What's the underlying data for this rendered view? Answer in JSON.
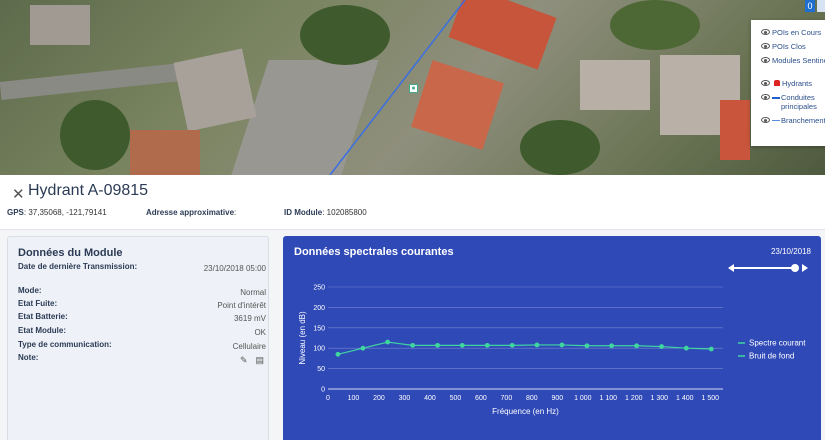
{
  "map": {
    "counter": "0"
  },
  "legend": {
    "items": [
      {
        "label": "POIs en Cours",
        "icon": "eye-slash-icon"
      },
      {
        "label": "POIs Clos",
        "icon": "eye-slash-icon"
      },
      {
        "label": "Modules Sentinel",
        "icon": "eye-icon"
      },
      {
        "label": "Hydrants",
        "icon": "hydrant-icon"
      },
      {
        "label": "Conduites principales",
        "icon": "line-icon"
      },
      {
        "label": "Branchement",
        "icon": "line-icon"
      }
    ]
  },
  "header": {
    "title": "Hydrant A-09815",
    "gps_label": "GPS",
    "gps_value": ": 37,35068, -121,79141",
    "address_label": "Adresse approximative",
    "address_value": ":",
    "module_label": "ID Module",
    "module_value": ": 102085800"
  },
  "module": {
    "title": "Données du Module",
    "rows": [
      {
        "key": "Date de dernière Transmission:",
        "value": "23/10/2018 05:00"
      },
      {
        "key": "Mode:",
        "value": "Normal"
      },
      {
        "key": "Etat Fuite:",
        "value": "Point d'intérêt"
      },
      {
        "key": "Etat Batterie:",
        "value": "3619 mV"
      },
      {
        "key": "Etat Module:",
        "value": "OK"
      },
      {
        "key": "Type de communication:",
        "value": "Cellulaire"
      },
      {
        "key": "Note:",
        "value": ""
      }
    ]
  },
  "spectral": {
    "title": "Données spectrales courantes",
    "date": "23/10/2018"
  },
  "colors": {
    "panel_blue": "#2f49b7",
    "series_green": "#3fd6a0"
  },
  "chart_data": {
    "type": "line",
    "xlabel": "Fréquence (en Hz)",
    "ylabel": "Niveau (en dB)",
    "xlim": [
      0,
      1550
    ],
    "ylim": [
      0,
      250
    ],
    "x_ticks": [
      0,
      100,
      200,
      300,
      400,
      500,
      600,
      700,
      800,
      900,
      1000,
      1100,
      1200,
      1300,
      1400,
      1500
    ],
    "x_tick_labels": [
      "0",
      "100",
      "200",
      "300",
      "400",
      "500",
      "600",
      "700",
      "800",
      "900",
      "1 000",
      "1 100",
      "1 200",
      "1 300",
      "1 400",
      "1 500"
    ],
    "y_ticks": [
      0,
      50,
      100,
      150,
      200,
      250
    ],
    "grid": true,
    "legend_position": "right",
    "series": [
      {
        "name": "Spectre courant",
        "x": [
          39,
          137,
          234,
          332,
          430,
          527,
          625,
          723,
          820,
          918,
          1016,
          1113,
          1211,
          1309,
          1406,
          1504
        ],
        "values": [
          85,
          100,
          115,
          107,
          107,
          107,
          107,
          107,
          108,
          108,
          106,
          106,
          106,
          104,
          100,
          98
        ]
      },
      {
        "name": "Bruit de fond",
        "x": [],
        "values": []
      }
    ]
  }
}
